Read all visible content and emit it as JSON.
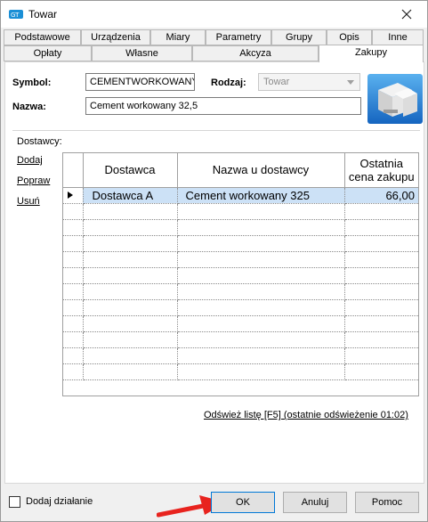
{
  "window": {
    "title": "Towar"
  },
  "tabs_row1": [
    "Podstawowe",
    "Urządzenia",
    "Miary",
    "Parametry",
    "Grupy",
    "Opis",
    "Inne"
  ],
  "tabs_row2": [
    "Opłaty",
    "Własne",
    "Akcyza",
    "Zakupy"
  ],
  "active_tab": "Zakupy",
  "form": {
    "symbol_label": "Symbol:",
    "symbol_value": "CEMENTWORKOWANY",
    "rodzaj_label": "Rodzaj:",
    "rodzaj_value": "Towar",
    "nazwa_label": "Nazwa:",
    "nazwa_value": "Cement workowany 32,5"
  },
  "suppliers": {
    "section_label": "Dostawcy:",
    "actions": [
      "Dodaj",
      "Popraw",
      "Usuń"
    ],
    "columns": [
      "Dostawca",
      "Nazwa u dostawcy",
      "Ostatnia\ncena zakupu"
    ],
    "rows": [
      {
        "supplier": "Dostawca A",
        "name": "Cement workowany 325",
        "price": "66,00",
        "selected": true
      }
    ],
    "refresh_link": "Odśwież listę [F5] (ostatnie odświeżenie 01:02)"
  },
  "footer": {
    "checkbox_label": "Dodaj działanie",
    "ok": "OK",
    "cancel": "Anuluj",
    "help": "Pomoc"
  },
  "colors": {
    "selection": "#cce1f6",
    "default_button_border": "#0078d7",
    "arrow": "#e8231e"
  }
}
